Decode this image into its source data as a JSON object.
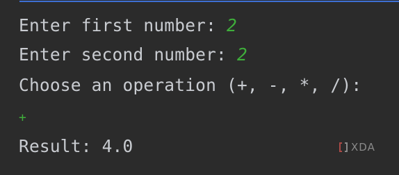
{
  "console": {
    "lines": [
      {
        "prompt": "Enter first number: ",
        "input": "2"
      },
      {
        "prompt": "Enter second number: ",
        "input": "2"
      },
      {
        "prompt": "Choose an operation (+, -, *, /):",
        "input": ""
      },
      {
        "prompt": "",
        "input": "+"
      },
      {
        "prompt": "Result: 4.0",
        "input": ""
      }
    ]
  },
  "watermark": {
    "text": "XDA",
    "icon": "xda-logo-icon"
  },
  "colors": {
    "background": "#2b2b2b",
    "text": "#c9ccd1",
    "user_input": "#3fae3b",
    "link_underline": "#3d6fd4"
  }
}
